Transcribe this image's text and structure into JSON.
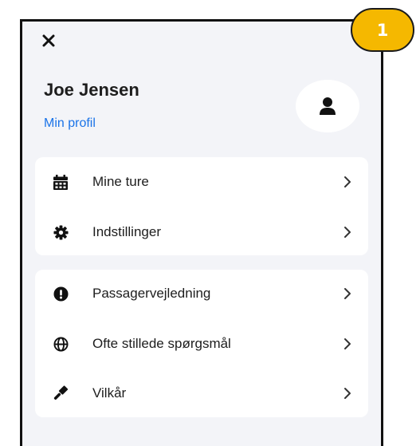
{
  "step_badge": "1",
  "header": {
    "user_name": "Joe Jensen",
    "profile_link": "Min profil"
  },
  "menu_group_1": [
    {
      "label": "Mine ture",
      "icon": "calendar-icon"
    },
    {
      "label": "Indstillinger",
      "icon": "gear-icon"
    }
  ],
  "menu_group_2": [
    {
      "label": "Passagervejledning",
      "icon": "exclamation-circle-icon"
    },
    {
      "label": "Ofte stillede spørgsmål",
      "icon": "globe-icon"
    },
    {
      "label": "Vilkår",
      "icon": "gavel-icon"
    }
  ],
  "colors": {
    "accent_link": "#1a73e8",
    "badge": "#f5b800",
    "panel_bg": "#f3f4f8"
  }
}
